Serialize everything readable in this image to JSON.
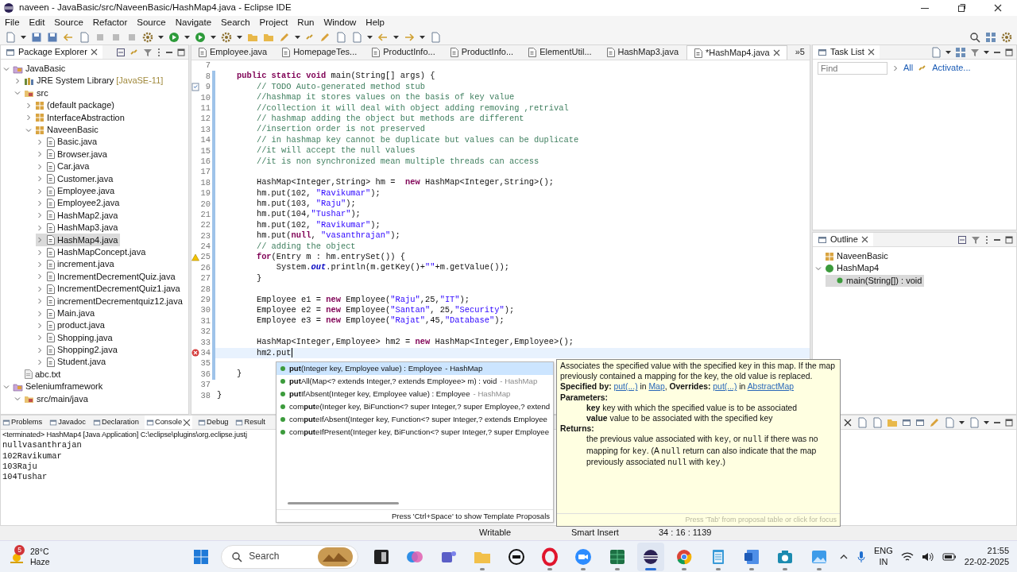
{
  "window": {
    "title": "naveen - JavaBasic/src/NaveenBasic/HashMap4.java - Eclipse IDE"
  },
  "menu": [
    "File",
    "Edit",
    "Source",
    "Refactor",
    "Source",
    "Navigate",
    "Search",
    "Project",
    "Run",
    "Window",
    "Help"
  ],
  "package_explorer": {
    "title": "Package Explorer",
    "tree": [
      {
        "label": "JavaBasic",
        "kind": "project",
        "expanded": true,
        "selected": false,
        "children": [
          {
            "label": "JRE System Library",
            "suffix": "[JavaSE-11]",
            "kind": "library",
            "expanded": false,
            "selected": false
          },
          {
            "label": "src",
            "kind": "folder",
            "expanded": true,
            "selected": false,
            "children": [
              {
                "label": "(default package)",
                "kind": "package",
                "expanded": false,
                "selected": false
              },
              {
                "label": "InterfaceAbstraction",
                "kind": "package",
                "expanded": false,
                "selected": false
              },
              {
                "label": "NaveenBasic",
                "kind": "package",
                "expanded": true,
                "selected": false,
                "children": [
                  {
                    "label": "Basic.java",
                    "kind": "java",
                    "expanded": false,
                    "selected": false
                  },
                  {
                    "label": "Browser.java",
                    "kind": "java",
                    "expanded": false,
                    "selected": false
                  },
                  {
                    "label": "Car.java",
                    "kind": "java",
                    "expanded": false,
                    "selected": false
                  },
                  {
                    "label": "Customer.java",
                    "kind": "java",
                    "expanded": false,
                    "selected": false
                  },
                  {
                    "label": "Employee.java",
                    "kind": "java",
                    "expanded": false,
                    "selected": false
                  },
                  {
                    "label": "Employee2.java",
                    "kind": "java",
                    "expanded": false,
                    "selected": false
                  },
                  {
                    "label": "HashMap2.java",
                    "kind": "java",
                    "expanded": false,
                    "selected": false
                  },
                  {
                    "label": "HashMap3.java",
                    "kind": "java",
                    "expanded": false,
                    "selected": false
                  },
                  {
                    "label": "HashMap4.java",
                    "kind": "java",
                    "expanded": false,
                    "selected": true
                  },
                  {
                    "label": "HashMapConcept.java",
                    "kind": "java",
                    "expanded": false,
                    "selected": false
                  },
                  {
                    "label": "increment.java",
                    "kind": "java",
                    "expanded": false,
                    "selected": false
                  },
                  {
                    "label": "IncrementDecrementQuiz.java",
                    "kind": "java",
                    "expanded": false,
                    "selected": false
                  },
                  {
                    "label": "IncrementDecrementQuiz1.java",
                    "kind": "java",
                    "expanded": false,
                    "selected": false
                  },
                  {
                    "label": "incrementDecrementquiz12.java",
                    "kind": "java",
                    "expanded": false,
                    "selected": false
                  },
                  {
                    "label": "Main.java",
                    "kind": "java",
                    "expanded": false,
                    "selected": false
                  },
                  {
                    "label": "product.java",
                    "kind": "java",
                    "expanded": false,
                    "selected": false
                  },
                  {
                    "label": "Shopping.java",
                    "kind": "java",
                    "expanded": false,
                    "selected": false
                  },
                  {
                    "label": "Shopping2.java",
                    "kind": "java",
                    "expanded": false,
                    "selected": false
                  },
                  {
                    "label": "Student.java",
                    "kind": "java",
                    "expanded": false,
                    "selected": false
                  }
                ]
              }
            ]
          },
          {
            "label": "abc.txt",
            "kind": "text",
            "selected": false
          }
        ]
      },
      {
        "label": "Seleniumframework",
        "kind": "project",
        "expanded": true,
        "selected": false,
        "children": [
          {
            "label": "src/main/java",
            "kind": "folder",
            "expanded": true,
            "selected": false
          }
        ]
      }
    ]
  },
  "editor": {
    "tabs": [
      {
        "label": "Employee.java",
        "selected": false
      },
      {
        "label": "HomepageTes...",
        "selected": false
      },
      {
        "label": "ProductInfo...",
        "selected": false
      },
      {
        "label": "ProductInfo...",
        "selected": false
      },
      {
        "label": "ElementUtil...",
        "selected": false
      },
      {
        "label": "HashMap3.java",
        "selected": false
      },
      {
        "label": "*HashMap4.java",
        "selected": true
      }
    ],
    "tabs_overflow": "»5",
    "lines": [
      {
        "number": "7",
        "kind": "plain",
        "changed": false,
        "current": false
      },
      {
        "number": "8",
        "kind": "plain",
        "changed": true,
        "current": false,
        "segments": [
          {
            "kind": "keyword",
            "text": "\tpublic static void"
          },
          {
            "kind": "plain",
            "text": " main(String[] args) {"
          }
        ]
      },
      {
        "number": "9",
        "kind": "task",
        "changed": true,
        "current": false,
        "segments": [
          {
            "kind": "comment",
            "text": "\t\t// TODO Auto-generated method stub"
          }
        ]
      },
      {
        "number": "10",
        "kind": "plain",
        "changed": true,
        "current": false,
        "segments": [
          {
            "kind": "comment",
            "text": "\t\t//hashmap it stores values on the basis of key value"
          }
        ]
      },
      {
        "number": "11",
        "kind": "plain",
        "changed": true,
        "current": false,
        "segments": [
          {
            "kind": "comment",
            "text": "\t\t//collection it will deal with object adding removing ,retrival"
          }
        ]
      },
      {
        "number": "12",
        "kind": "plain",
        "changed": true,
        "current": false,
        "segments": [
          {
            "kind": "comment",
            "text": "\t\t// hashmap adding the object but methods are different"
          }
        ]
      },
      {
        "number": "13",
        "kind": "plain",
        "changed": true,
        "current": false,
        "segments": [
          {
            "kind": "comment",
            "text": "\t\t//insertion order is not preserved"
          }
        ]
      },
      {
        "number": "14",
        "kind": "plain",
        "changed": true,
        "current": false,
        "segments": [
          {
            "kind": "comment",
            "text": "\t\t// in hashmap key cannot be duplicate but values can be duplicate"
          }
        ]
      },
      {
        "number": "15",
        "kind": "plain",
        "changed": true,
        "current": false,
        "segments": [
          {
            "kind": "comment",
            "text": "\t\t//it will accept the null values"
          }
        ]
      },
      {
        "number": "16",
        "kind": "plain",
        "changed": true,
        "current": false,
        "segments": [
          {
            "kind": "comment",
            "text": "\t\t//it is non synchronized mean multiple threads can access"
          }
        ]
      },
      {
        "number": "17",
        "kind": "plain",
        "changed": true,
        "current": false
      },
      {
        "number": "18",
        "kind": "plain",
        "changed": true,
        "current": false,
        "segments": [
          {
            "kind": "plain",
            "text": "\t\tHashMap<Integer,String> hm =  "
          },
          {
            "kind": "keyword",
            "text": "new"
          },
          {
            "kind": "plain",
            "text": " HashMap<Integer,String>();"
          }
        ]
      },
      {
        "number": "19",
        "kind": "plain",
        "changed": true,
        "current": false,
        "segments": [
          {
            "kind": "plain",
            "text": "\t\thm.put(102, "
          },
          {
            "kind": "string",
            "text": "\"Ravikumar\""
          },
          {
            "kind": "plain",
            "text": ");"
          }
        ]
      },
      {
        "number": "20",
        "kind": "plain",
        "changed": true,
        "current": false,
        "segments": [
          {
            "kind": "plain",
            "text": "\t\thm.put(103, "
          },
          {
            "kind": "string",
            "text": "\"Raju\""
          },
          {
            "kind": "plain",
            "text": ");"
          }
        ]
      },
      {
        "number": "21",
        "kind": "plain",
        "changed": true,
        "current": false,
        "segments": [
          {
            "kind": "plain",
            "text": "\t\thm.put(104,"
          },
          {
            "kind": "string",
            "text": "\"Tushar\""
          },
          {
            "kind": "plain",
            "text": ");"
          }
        ]
      },
      {
        "number": "22",
        "kind": "plain",
        "changed": true,
        "current": false,
        "segments": [
          {
            "kind": "plain",
            "text": "\t\thm.put(102, "
          },
          {
            "kind": "string",
            "text": "\"Ravikumar\""
          },
          {
            "kind": "plain",
            "text": ");"
          }
        ]
      },
      {
        "number": "23",
        "kind": "plain",
        "changed": true,
        "current": false,
        "segments": [
          {
            "kind": "plain",
            "text": "\t\thm.put("
          },
          {
            "kind": "keyword",
            "text": "null"
          },
          {
            "kind": "plain",
            "text": ", "
          },
          {
            "kind": "string",
            "text": "\"vasanthrajan\""
          },
          {
            "kind": "plain",
            "text": ");"
          }
        ]
      },
      {
        "number": "24",
        "kind": "plain",
        "changed": true,
        "current": false,
        "segments": [
          {
            "kind": "comment",
            "text": "\t\t// adding the object"
          }
        ]
      },
      {
        "number": "25",
        "kind": "warning",
        "changed": true,
        "current": false,
        "segments": [
          {
            "kind": "keyword",
            "text": "\t\tfor"
          },
          {
            "kind": "plain",
            "text": "(Entry m : hm.entrySet()) {"
          }
        ]
      },
      {
        "number": "26",
        "kind": "plain",
        "changed": true,
        "current": false,
        "segments": [
          {
            "kind": "plain",
            "text": "\t\t\tSystem."
          },
          {
            "kind": "field",
            "text": "out"
          },
          {
            "kind": "plain",
            "text": ".println(m.getKey()+"
          },
          {
            "kind": "string",
            "text": "\"\""
          },
          {
            "kind": "plain",
            "text": "+m.getValue());"
          }
        ]
      },
      {
        "number": "27",
        "kind": "plain",
        "changed": true,
        "current": false,
        "segments": [
          {
            "kind": "plain",
            "text": "\t\t}"
          }
        ]
      },
      {
        "number": "28",
        "kind": "plain",
        "changed": true,
        "current": false
      },
      {
        "number": "29",
        "kind": "plain",
        "changed": true,
        "current": false,
        "segments": [
          {
            "kind": "plain",
            "text": "\t\tEmployee e1 = "
          },
          {
            "kind": "keyword",
            "text": "new"
          },
          {
            "kind": "plain",
            "text": " Employee("
          },
          {
            "kind": "string",
            "text": "\"Raju\""
          },
          {
            "kind": "plain",
            "text": ",25,"
          },
          {
            "kind": "string",
            "text": "\"IT\""
          },
          {
            "kind": "plain",
            "text": ");"
          }
        ]
      },
      {
        "number": "30",
        "kind": "plain",
        "changed": true,
        "current": false,
        "segments": [
          {
            "kind": "plain",
            "text": "\t\tEmployee e2 = "
          },
          {
            "kind": "keyword",
            "text": "new"
          },
          {
            "kind": "plain",
            "text": " Employee("
          },
          {
            "kind": "string",
            "text": "\"Santan\""
          },
          {
            "kind": "plain",
            "text": ", 25,"
          },
          {
            "kind": "string",
            "text": "\"Security\""
          },
          {
            "kind": "plain",
            "text": ");"
          }
        ]
      },
      {
        "number": "31",
        "kind": "plain",
        "changed": true,
        "current": false,
        "segments": [
          {
            "kind": "plain",
            "text": "\t\tEmployee e3 = "
          },
          {
            "kind": "keyword",
            "text": "new"
          },
          {
            "kind": "plain",
            "text": " Employee("
          },
          {
            "kind": "string",
            "text": "\"Rajat\""
          },
          {
            "kind": "plain",
            "text": ",45,"
          },
          {
            "kind": "string",
            "text": "\"Database\""
          },
          {
            "kind": "plain",
            "text": ");"
          }
        ]
      },
      {
        "number": "32",
        "kind": "plain",
        "changed": true,
        "current": false
      },
      {
        "number": "33",
        "kind": "plain",
        "changed": true,
        "current": false,
        "segments": [
          {
            "kind": "plain",
            "text": "\t\tHashMap<Integer,Employee> hm2 = "
          },
          {
            "kind": "keyword",
            "text": "new"
          },
          {
            "kind": "plain",
            "text": " HashMap<Integer,Employee>();"
          }
        ]
      },
      {
        "number": "34",
        "kind": "error",
        "changed": true,
        "current": true,
        "segments": [
          {
            "kind": "plain",
            "text": "\t\thm2.put"
          }
        ]
      },
      {
        "number": "35",
        "kind": "plain",
        "changed": true,
        "current": false
      },
      {
        "number": "36",
        "kind": "plain",
        "changed": true,
        "current": false,
        "segments": [
          {
            "kind": "plain",
            "text": "\t}"
          }
        ]
      },
      {
        "number": "37",
        "kind": "plain",
        "changed": false,
        "current": false
      },
      {
        "number": "38",
        "kind": "plain",
        "changed": false,
        "current": false,
        "segments": [
          {
            "kind": "plain",
            "text": "}"
          }
        ]
      }
    ]
  },
  "completion": {
    "items": [
      {
        "label": "**put**(Integer key, Employee value) : Employee",
        "qualifier": " - HashMap",
        "selected": true
      },
      {
        "label": "**put**All(Map<? extends Integer,? extends Employee> m) : void",
        "qualifier": " - HashMap",
        "selected": false
      },
      {
        "label": "**put**IfAbsent(Integer key, Employee value) : Employee",
        "qualifier": " - HashMap",
        "selected": false
      },
      {
        "label": "com**put**e(Integer key, BiFunction<? super Integer,? super Employee,? extend",
        "selected": false
      },
      {
        "label": "com**put**eIfAbsent(Integer key, Function<? super Integer,? extends Employee",
        "selected": false
      },
      {
        "label": "com**put**eIfPresent(Integer key, BiFunction<? super Integer,? super Employee",
        "selected": false
      }
    ],
    "hint": "Press 'Ctrl+Space' to show Template Proposals"
  },
  "javadoc": {
    "blocks": [
      {
        "kind": "paragraph",
        "segments": [
          {
            "kind": "plain",
            "text": "Associates the specified value with the specified key in this map. If the map previously contained a mapping for the key, the old value is replaced."
          }
        ]
      },
      {
        "kind": "paragraph",
        "segments": [
          {
            "kind": "bold",
            "text": "Specified by: "
          },
          {
            "kind": "link",
            "text": "put(...)"
          },
          {
            "kind": "plain",
            "text": " in "
          },
          {
            "kind": "link",
            "text": "Map"
          },
          {
            "kind": "plain",
            "text": ", "
          },
          {
            "kind": "bold",
            "text": "Overrides: "
          },
          {
            "kind": "link",
            "text": "put(...)"
          },
          {
            "kind": "plain",
            "text": " in "
          },
          {
            "kind": "link",
            "text": "AbstractMap"
          }
        ]
      },
      {
        "kind": "heading",
        "segments": [
          {
            "kind": "bold",
            "text": "Parameters:"
          }
        ]
      },
      {
        "kind": "indented",
        "segments": [
          {
            "kind": "bold",
            "text": "key"
          },
          {
            "kind": "plain",
            "text": " key with which the specified value is to be associated"
          }
        ]
      },
      {
        "kind": "indented",
        "segments": [
          {
            "kind": "bold",
            "text": "value"
          },
          {
            "kind": "plain",
            "text": " value to be associated with the specified key"
          }
        ]
      },
      {
        "kind": "heading",
        "segments": [
          {
            "kind": "bold",
            "text": "Returns:"
          }
        ]
      },
      {
        "kind": "indented",
        "segments": [
          {
            "kind": "plain",
            "text": "the previous value associated with "
          },
          {
            "kind": "code",
            "text": "key"
          },
          {
            "kind": "plain",
            "text": ", or "
          },
          {
            "kind": "code",
            "text": "null"
          },
          {
            "kind": "plain",
            "text": " if there was no mapping for "
          },
          {
            "kind": "code",
            "text": "key"
          },
          {
            "kind": "plain",
            "text": ". (A "
          },
          {
            "kind": "code",
            "text": "null"
          },
          {
            "kind": "plain",
            "text": " return can also indicate that the map previously associated "
          },
          {
            "kind": "code",
            "text": "null"
          },
          {
            "kind": "plain",
            "text": " with "
          },
          {
            "kind": "code",
            "text": "key"
          },
          {
            "kind": "plain",
            "text": ".)"
          }
        ]
      }
    ],
    "hint": "Press 'Tab' from proposal table or click for focus"
  },
  "task_list": {
    "title": "Task List",
    "find": {
      "placeholder": "Find"
    },
    "links": [
      "All",
      "Activate..."
    ]
  },
  "outline": {
    "title": "Outline",
    "tree": [
      {
        "label": "NaveenBasic",
        "kind": "package",
        "selected": false
      },
      {
        "label": "HashMap4",
        "kind": "class",
        "expanded": true,
        "selected": false,
        "children": [
          {
            "label": "main(String[]) : void",
            "kind": "method",
            "selected": true
          }
        ]
      }
    ]
  },
  "console": {
    "tabs": [
      {
        "label": "Problems",
        "selected": false
      },
      {
        "label": "Javadoc",
        "selected": false
      },
      {
        "label": "Declaration",
        "selected": false
      },
      {
        "label": "Console",
        "selected": true
      },
      {
        "label": "Debug",
        "selected": false
      },
      {
        "label": "Result",
        "selected": false
      }
    ],
    "process": "<terminated> HashMap4 [Java Application] C:\\eclipse\\plugins\\org.eclipse.justj",
    "output": [
      "nullvasanthrajan",
      "102Ravikumar",
      "103Raju",
      "104Tushar"
    ]
  },
  "status_bar": [
    "Writable",
    "Smart Insert",
    "34 : 16 : 1139"
  ],
  "taskbar": {
    "weather": {
      "badge": "5",
      "temperature": "28°C",
      "condition": "Haze"
    },
    "search": {
      "placeholder": "Search"
    },
    "apps": [
      {
        "running": false,
        "active": false
      },
      {
        "running": false,
        "active": false
      },
      {
        "running": false,
        "active": false
      },
      {
        "running": true,
        "active": false
      },
      {
        "running": false,
        "active": false
      },
      {
        "running": true,
        "active": false
      },
      {
        "running": true,
        "active": false
      },
      {
        "running": true,
        "active": false
      },
      {
        "running": true,
        "active": true
      },
      {
        "running": true,
        "active": false
      },
      {
        "running": true,
        "active": false
      },
      {
        "running": true,
        "active": false
      },
      {
        "running": true,
        "active": false
      },
      {
        "running": true,
        "active": false
      }
    ],
    "language": [
      "ENG",
      "IN"
    ],
    "time": "21:55",
    "date": "22-02-2025"
  }
}
